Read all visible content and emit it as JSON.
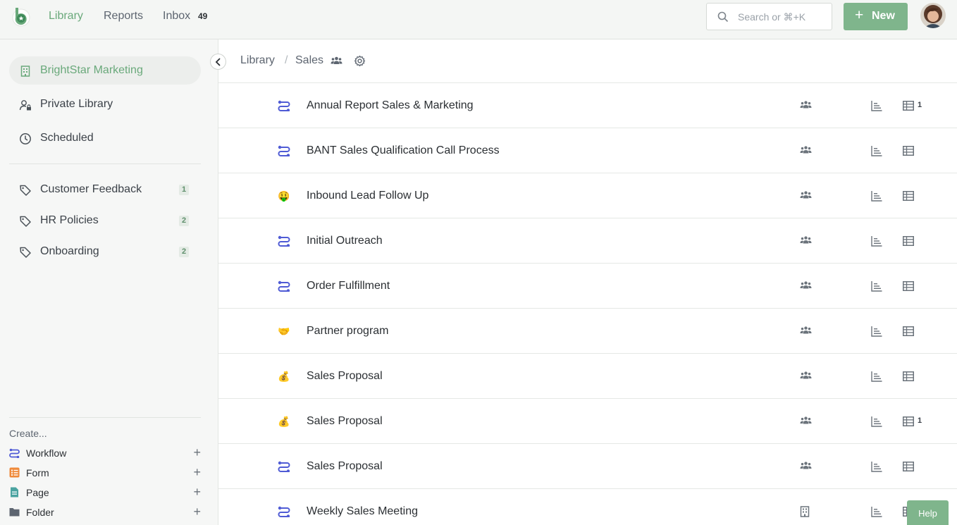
{
  "nav": {
    "library": "Library",
    "reports": "Reports",
    "inbox": "Inbox",
    "inbox_count": "49"
  },
  "search": {
    "placeholder": "Search or ⌘+K"
  },
  "new_button": {
    "icon": "+",
    "label": "New"
  },
  "sidebar": {
    "main": [
      {
        "label": "BrightStar Marketing",
        "icon": "building-icon",
        "active": true
      },
      {
        "label": "Private Library",
        "icon": "person-lock-icon"
      },
      {
        "label": "Scheduled",
        "icon": "clock-icon"
      }
    ],
    "tags": [
      {
        "label": "Customer Feedback",
        "count": "1"
      },
      {
        "label": "HR Policies",
        "count": "2"
      },
      {
        "label": "Onboarding",
        "count": "2"
      }
    ],
    "create_label": "Create...",
    "create": [
      {
        "label": "Workflow",
        "icon": "workflow-icon",
        "color": "#4f5bd5"
      },
      {
        "label": "Form",
        "icon": "form-icon",
        "color": "#ef8a3a"
      },
      {
        "label": "Page",
        "icon": "page-icon",
        "color": "#4aa3a0"
      },
      {
        "label": "Folder",
        "icon": "folder-icon",
        "color": "#5d6570"
      }
    ],
    "create_plus": "+"
  },
  "breadcrumb": {
    "root": "Library",
    "sep": "/",
    "current": "Sales"
  },
  "rows": [
    {
      "name": "Annual Report Sales & Marketing",
      "icon": "workflow-icon",
      "share": "group-icon",
      "count": "1"
    },
    {
      "name": "BANT Sales Qualification Call Process",
      "icon": "workflow-icon",
      "share": "group-icon",
      "count": ""
    },
    {
      "name": "Inbound Lead Follow Up",
      "icon": "money-face-emoji",
      "emoji": "🤑",
      "share": "group-icon",
      "count": ""
    },
    {
      "name": "Initial Outreach",
      "icon": "workflow-icon",
      "share": "group-icon",
      "count": ""
    },
    {
      "name": "Order Fulfillment",
      "icon": "workflow-icon",
      "share": "group-icon",
      "count": ""
    },
    {
      "name": "Partner program",
      "icon": "handshake-emoji",
      "emoji": "🤝",
      "share": "group-icon",
      "count": ""
    },
    {
      "name": "Sales Proposal",
      "icon": "money-bag-emoji",
      "emoji": "💰",
      "share": "group-icon",
      "count": ""
    },
    {
      "name": "Sales Proposal",
      "icon": "money-bag-emoji",
      "emoji": "💰",
      "share": "group-icon",
      "count": "1"
    },
    {
      "name": "Sales Proposal",
      "icon": "workflow-icon",
      "share": "group-icon",
      "count": ""
    },
    {
      "name": "Weekly Sales Meeting",
      "icon": "workflow-icon",
      "share": "building-icon",
      "count": ""
    }
  ],
  "help": "Help",
  "colors": {
    "accent": "#7fb58c",
    "accent_text": "#6aa97b",
    "workflow": "#4f5bd5"
  }
}
